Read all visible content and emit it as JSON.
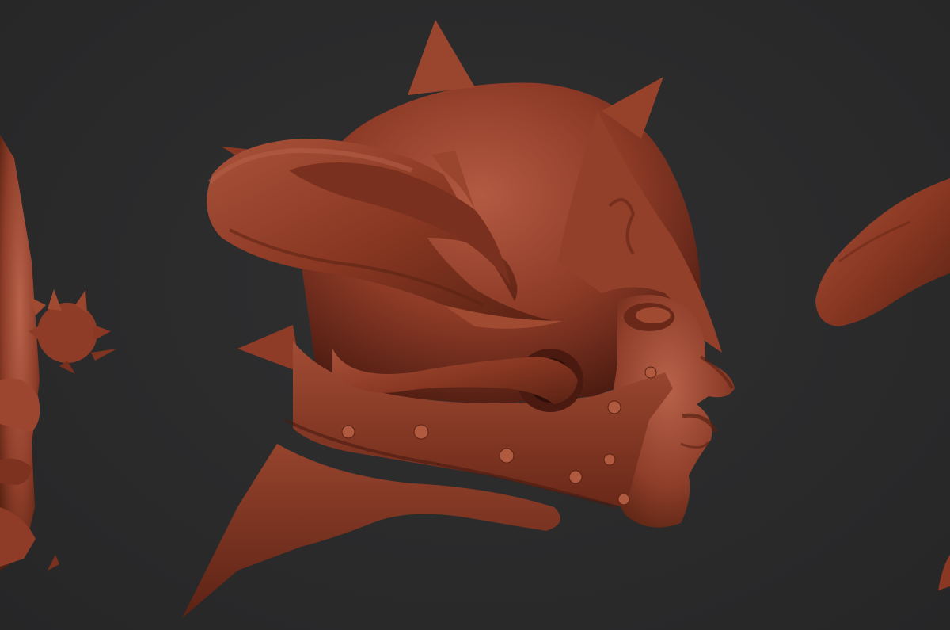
{
  "scene": {
    "background_color": "#2a2a2b",
    "clay_color": "#8c3a26",
    "clay_highlight": "#b35a42",
    "clay_shadow": "#4a1a10",
    "subjects": [
      "partial-left-head",
      "horned-spiked-helmet-head",
      "partial-right-horn"
    ]
  }
}
